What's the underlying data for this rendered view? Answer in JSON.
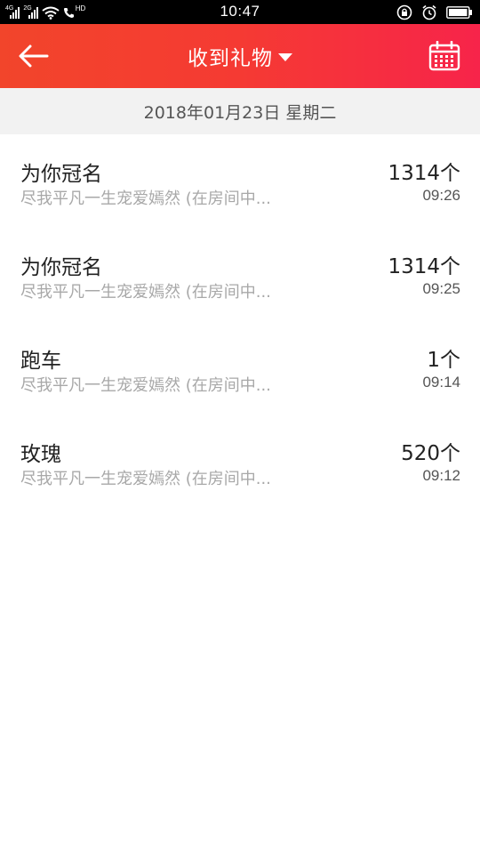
{
  "status_bar": {
    "time": "10:47",
    "network_1": "4G",
    "network_2": "2G",
    "volte": "HD",
    "icons": [
      "signal-icon",
      "signal-icon",
      "wifi-icon",
      "phone-hd-icon",
      "lock-rotation-icon",
      "alarm-icon",
      "battery-icon"
    ]
  },
  "header": {
    "title": "收到礼物",
    "back_icon": "arrow-left-icon",
    "dropdown_icon": "caret-down-icon",
    "calendar_icon": "calendar-icon",
    "gradient_start": "#f2452b",
    "gradient_end": "#f7244a"
  },
  "date_header": {
    "label": "2018年01月23日 星期二"
  },
  "gifts": [
    {
      "name": "为你冠名",
      "count": "1314个",
      "desc": "尽我平凡一生宠爱嫣然 (在房间中...",
      "time": "09:26"
    },
    {
      "name": "为你冠名",
      "count": "1314个",
      "desc": "尽我平凡一生宠爱嫣然 (在房间中...",
      "time": "09:25"
    },
    {
      "name": "跑车",
      "count": "1个",
      "desc": "尽我平凡一生宠爱嫣然 (在房间中...",
      "time": "09:14"
    },
    {
      "name": "玫瑰",
      "count": "520个",
      "desc": "尽我平凡一生宠爱嫣然 (在房间中...",
      "time": "09:12"
    }
  ]
}
